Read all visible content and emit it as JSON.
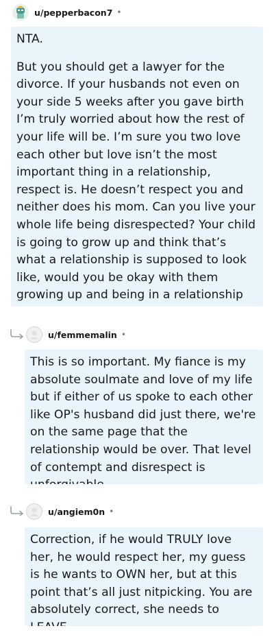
{
  "comments": [
    {
      "username": "u/pepperbacon7",
      "dot": "•",
      "paragraphs": [
        "NTA.",
        "But you should get a lawyer for the divorce. If your husbands not even on your side 5 weeks after you gave birth I’m truly worried about how the rest of your life will be. I’m sure you two love each other but love isn’t the most important thing in a relationship, respect is. He doesn’t respect you and neither does his mom. Can you live your whole life being disrespected? Your child is going to grow up and think that’s what a relationship is supposed to look like, would you be okay with them growing up and being in a relationship like yours?"
      ]
    },
    {
      "username": "u/femmemalin",
      "dot": "•",
      "paragraphs": [
        "This is so important. My fiance is my absolute soulmate and love of my life but if either of us spoke to each other like OP's husband did just there, we're on the same page that the relationship would be over. That level of contempt and disrespect is unforgivable."
      ]
    },
    {
      "username": "u/angiem0n",
      "dot": "•",
      "paragraphs": [
        "Correction, if he would TRULY love her, he would respect her, my guess is he wants to OWN her, but at this point that’s all just nitpicking. You are absolutely correct, she needs to LEAVE."
      ]
    }
  ]
}
